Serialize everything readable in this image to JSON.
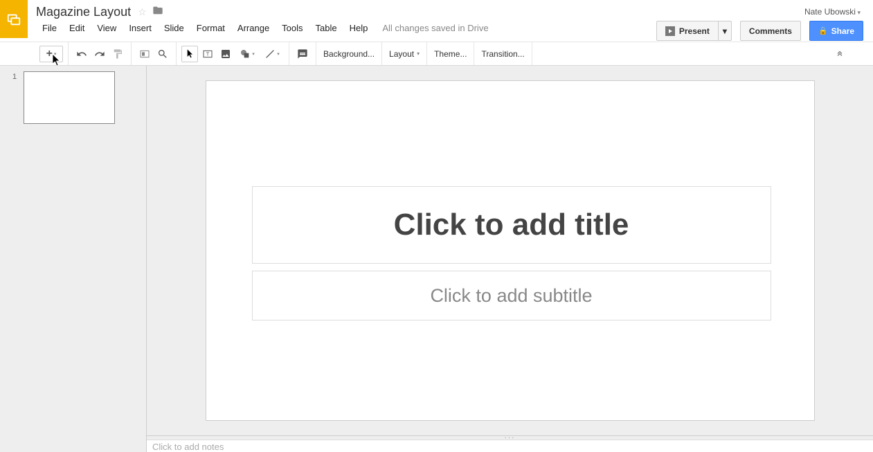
{
  "document": {
    "title": "Magazine Layout",
    "save_status": "All changes saved in Drive"
  },
  "user": {
    "name": "Nate Ubowski"
  },
  "menus": {
    "file": "File",
    "edit": "Edit",
    "view": "View",
    "insert": "Insert",
    "slide": "Slide",
    "format": "Format",
    "arrange": "Arrange",
    "tools": "Tools",
    "table": "Table",
    "help": "Help"
  },
  "header_buttons": {
    "present": "Present",
    "comments": "Comments",
    "share": "Share"
  },
  "toolbar": {
    "background": "Background...",
    "layout": "Layout",
    "theme": "Theme...",
    "transition": "Transition..."
  },
  "slides": [
    {
      "number": "1"
    }
  ],
  "canvas": {
    "title_placeholder": "Click to add title",
    "subtitle_placeholder": "Click to add subtitle"
  },
  "notes": {
    "placeholder": "Click to add notes"
  }
}
